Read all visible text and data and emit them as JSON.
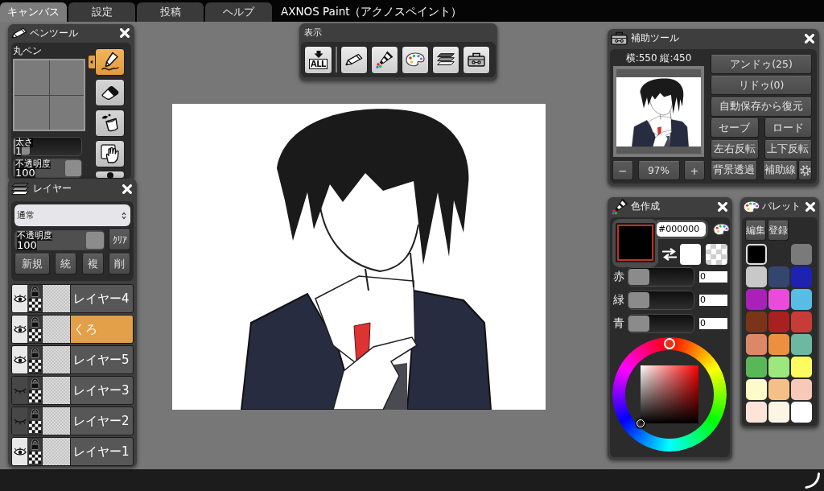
{
  "menu_tabs": [
    {
      "label": "キャンバス",
      "selected": true
    },
    {
      "label": "設定",
      "selected": false
    },
    {
      "label": "投稿",
      "selected": false
    },
    {
      "label": "ヘルプ",
      "selected": false
    }
  ],
  "app_title": "AXNOS Paint（アクノスペイント）",
  "pen_tool": {
    "title": "ペンツール",
    "brush_name": "丸ペン",
    "tools": [
      {
        "kind": "pen",
        "selected": true
      },
      {
        "kind": "eraser",
        "selected": false
      },
      {
        "kind": "bucket",
        "selected": false
      },
      {
        "kind": "hand",
        "selected": false
      },
      {
        "kind": "dot",
        "selected": false
      }
    ],
    "sliders": [
      {
        "label": "太さ",
        "value": "1",
        "level": 0
      },
      {
        "label": "不透明度",
        "value": "100",
        "level": 1
      }
    ]
  },
  "layers": {
    "title": "レイヤー",
    "blend_mode": "通常",
    "opacity": {
      "label": "不透明度",
      "value": "100",
      "level": 1
    },
    "clear_button": "ｸﾘｱ",
    "buttons": [
      "新規",
      "統",
      "複",
      "削"
    ],
    "items": [
      {
        "name": "レイヤー4",
        "visible": true,
        "selected": false
      },
      {
        "name": "くろ",
        "visible": true,
        "selected": true
      },
      {
        "name": "レイヤー5",
        "visible": true,
        "selected": false
      },
      {
        "name": "レイヤー3",
        "visible": false,
        "selected": false
      },
      {
        "name": "レイヤー2",
        "visible": false,
        "selected": false
      },
      {
        "name": "レイヤー1",
        "visible": true,
        "selected": false
      }
    ]
  },
  "display_toolbar": {
    "title": "表示",
    "buttons": [
      {
        "kind": "show-all",
        "label": "ALL"
      },
      {
        "kind": "pen"
      },
      {
        "kind": "color"
      },
      {
        "kind": "palette"
      },
      {
        "kind": "layers"
      },
      {
        "kind": "helper"
      }
    ]
  },
  "helper_tool": {
    "title": "補助ツール",
    "canvas_size": "横:550 縦:450",
    "zoom_out": "−",
    "zoom": "97%",
    "zoom_in": "+",
    "button_rows": [
      [
        "アンドゥ(25)"
      ],
      [
        "リドゥ(0)"
      ],
      [
        "自動保存から復元"
      ],
      [
        "セーブ",
        "ロード"
      ],
      [
        "左右反転",
        "上下反転"
      ],
      [
        "背景透過",
        "補助線"
      ]
    ]
  },
  "color_maker": {
    "title": "色作成",
    "hex": "#000000",
    "channels": [
      {
        "label": "赤",
        "value": "0",
        "level": 0
      },
      {
        "label": "緑",
        "value": "0",
        "level": 0
      },
      {
        "label": "青",
        "value": "0",
        "level": 0
      }
    ]
  },
  "palette": {
    "title": "パレット",
    "buttons": [
      "編集",
      "登録"
    ],
    "swatches": [
      {
        "kind": "color",
        "color": "#000000",
        "selected": true
      },
      {
        "kind": "empty"
      },
      {
        "kind": "color",
        "color": "#7a7a7a",
        "selected": false
      },
      {
        "kind": "color",
        "color": "#c8c8c8",
        "selected": false
      },
      {
        "kind": "color",
        "color": "#34466e",
        "selected": false
      },
      {
        "kind": "color",
        "color": "#1e22b0",
        "selected": false
      },
      {
        "kind": "color",
        "color": "#a822b8",
        "selected": false
      },
      {
        "kind": "color",
        "color": "#e84cd8",
        "selected": false
      },
      {
        "kind": "color",
        "color": "#58bce4",
        "selected": false
      },
      {
        "kind": "color",
        "color": "#7c3418",
        "selected": false
      },
      {
        "kind": "color",
        "color": "#a82020",
        "selected": false
      },
      {
        "kind": "color",
        "color": "#c83c38",
        "selected": false
      },
      {
        "kind": "color",
        "color": "#dc8868",
        "selected": false
      },
      {
        "kind": "color",
        "color": "#ec9040",
        "selected": false
      },
      {
        "kind": "color",
        "color": "#6cb8a0",
        "selected": false
      },
      {
        "kind": "color",
        "color": "#58b858",
        "selected": false
      },
      {
        "kind": "color",
        "color": "#9ce87c",
        "selected": false
      },
      {
        "kind": "color",
        "color": "#fcfc60",
        "selected": false
      },
      {
        "kind": "color",
        "color": "#fcfcc8",
        "selected": false
      },
      {
        "kind": "color",
        "color": "#f4c088",
        "selected": false
      },
      {
        "kind": "color",
        "color": "#f8c8b8",
        "selected": false
      },
      {
        "kind": "color",
        "color": "#fce4d8",
        "selected": false
      },
      {
        "kind": "color",
        "color": "#fcf4e4",
        "selected": false
      },
      {
        "kind": "color",
        "color": "#ffffff",
        "selected": false
      }
    ]
  }
}
